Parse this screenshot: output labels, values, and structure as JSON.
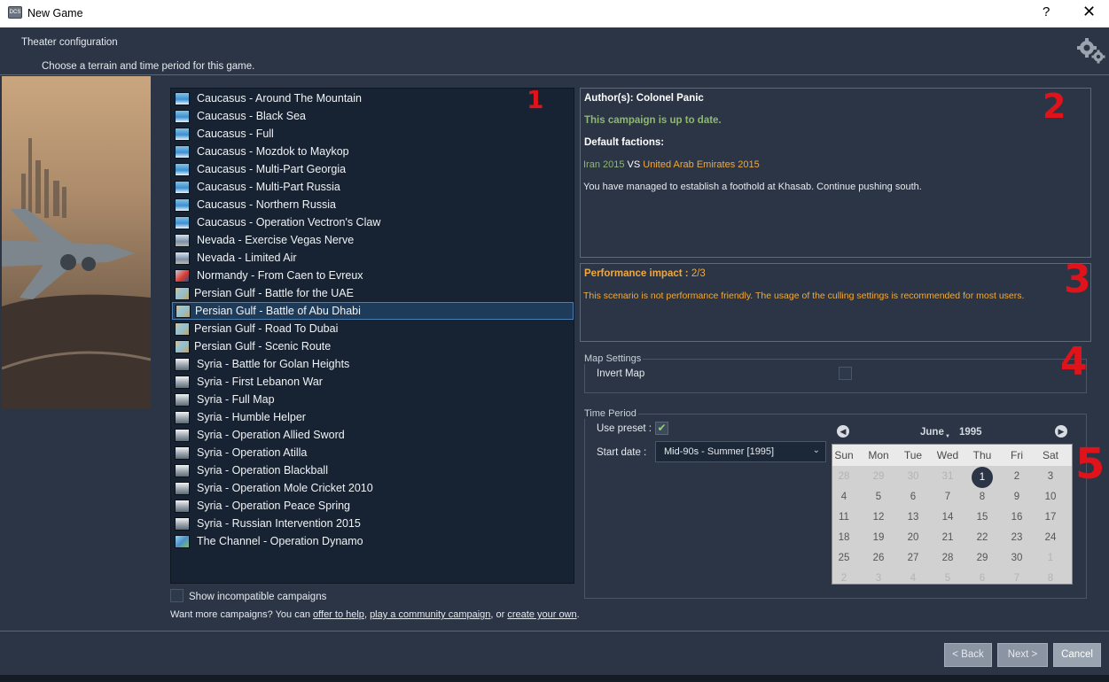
{
  "window": {
    "title": "New Game",
    "help_label": "?",
    "close_label": "✕",
    "app_icon_text": "DCS"
  },
  "header": {
    "title": "Theater configuration",
    "subtitle": "Choose a terrain and time period for this game."
  },
  "campaigns": [
    {
      "label": "Caucasus - Around The Mountain",
      "theater": "caucasus"
    },
    {
      "label": "Caucasus - Black Sea",
      "theater": "caucasus"
    },
    {
      "label": "Caucasus - Full",
      "theater": "caucasus"
    },
    {
      "label": "Caucasus - Mozdok to Maykop",
      "theater": "caucasus"
    },
    {
      "label": "Caucasus - Multi-Part Georgia",
      "theater": "caucasus"
    },
    {
      "label": "Caucasus - Multi-Part Russia",
      "theater": "caucasus"
    },
    {
      "label": "Caucasus - Northern Russia",
      "theater": "caucasus"
    },
    {
      "label": "Caucasus - Operation Vectron's Claw",
      "theater": "caucasus"
    },
    {
      "label": "Nevada - Exercise Vegas Nerve",
      "theater": "nevada"
    },
    {
      "label": "Nevada - Limited Air",
      "theater": "nevada"
    },
    {
      "label": "Normandy - From Caen to Evreux",
      "theater": "normandy"
    },
    {
      "label": "Persian Gulf - Battle for the UAE",
      "theater": "pg"
    },
    {
      "label": "Persian Gulf - Battle of Abu Dhabi",
      "theater": "pg",
      "selected": true
    },
    {
      "label": "Persian Gulf - Road To Dubai",
      "theater": "pg"
    },
    {
      "label": "Persian Gulf - Scenic Route",
      "theater": "pg"
    },
    {
      "label": "Syria - Battle for Golan Heights",
      "theater": "syria"
    },
    {
      "label": "Syria - First Lebanon War",
      "theater": "syria"
    },
    {
      "label": "Syria - Full Map",
      "theater": "syria"
    },
    {
      "label": "Syria - Humble Helper",
      "theater": "syria"
    },
    {
      "label": "Syria - Operation Allied Sword",
      "theater": "syria"
    },
    {
      "label": "Syria - Operation Atilla",
      "theater": "syria"
    },
    {
      "label": "Syria - Operation Blackball",
      "theater": "syria"
    },
    {
      "label": "Syria - Operation Mole Cricket 2010",
      "theater": "syria"
    },
    {
      "label": "Syria - Operation Peace Spring",
      "theater": "syria"
    },
    {
      "label": "Syria - Russian Intervention 2015",
      "theater": "syria"
    },
    {
      "label": "The Channel - Operation Dynamo",
      "theater": "channel"
    }
  ],
  "show_incompatible_label": "Show incompatible campaigns",
  "more_campaigns": {
    "prefix": "Want more campaigns? You can ",
    "link1": "offer to help",
    "sep1": ", ",
    "link2": "play a community campaign",
    "sep2": ", or ",
    "link3": "create your own",
    "suffix": "."
  },
  "info": {
    "author": "Author(s): Colonel Panic",
    "up_to_date": "This campaign is up to date.",
    "factions_title": "Default factions:",
    "red_faction": "Iran 2015",
    "vs": " VS ",
    "blue_faction": "United Arab Emirates 2015",
    "description": "You have managed to establish a foothold at Khasab. Continue pushing south."
  },
  "performance": {
    "label": "Performance impact :",
    "value": "2/3",
    "description": "This scenario is not performance friendly. The usage of the culling settings is recommended for most users."
  },
  "map_settings": {
    "title": "Map Settings",
    "invert_label": "Invert Map",
    "invert_checked": false
  },
  "time_period": {
    "title": "Time Period",
    "use_preset_label": "Use preset :",
    "use_preset_checked": true,
    "check_mark": "✔",
    "start_date_label": "Start date :",
    "start_date_value": "Mid-90s - Summer [1995]",
    "select_arrow": "⌄"
  },
  "calendar": {
    "month": "June",
    "year": "1995",
    "prev": "◀",
    "next": "▶",
    "month_arrow": "▼",
    "weekdays": [
      "Sun",
      "Mon",
      "Tue",
      "Wed",
      "Thu",
      "Fri",
      "Sat"
    ],
    "weeks": [
      [
        "28",
        "29",
        "30",
        "31",
        "1",
        "2",
        "3"
      ],
      [
        "4",
        "5",
        "6",
        "7",
        "8",
        "9",
        "10"
      ],
      [
        "11",
        "12",
        "13",
        "14",
        "15",
        "16",
        "17"
      ],
      [
        "18",
        "19",
        "20",
        "21",
        "22",
        "23",
        "24"
      ],
      [
        "25",
        "26",
        "27",
        "28",
        "29",
        "30",
        "1"
      ],
      [
        "2",
        "3",
        "4",
        "5",
        "6",
        "7",
        "8"
      ]
    ],
    "selected_day": "1"
  },
  "buttons": {
    "back": "< Back",
    "next": "Next >",
    "cancel": "Cancel"
  },
  "annotations": [
    "1",
    "2",
    "3",
    "4",
    "5"
  ],
  "colors": {
    "background": "#2b3545",
    "list_bg": "#172333",
    "accent_green": "#8fb870",
    "accent_orange": "#f2a93c",
    "annotation_red": "#e0131a"
  }
}
